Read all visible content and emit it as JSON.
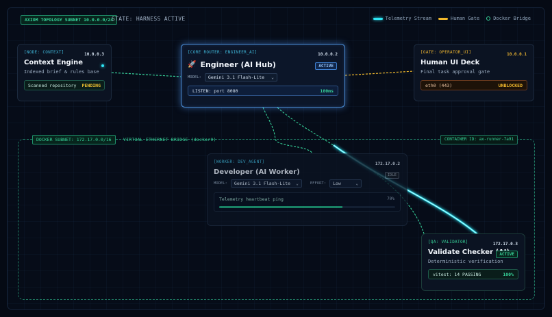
{
  "header": {
    "badge": "AXIOM TOPOLOGY SUBNET 10.0.0.0/24",
    "state": "STATE: HARNESS ACTIVE",
    "legend": [
      {
        "label": "Telemetry Stream",
        "color": "#2ee6f5"
      },
      {
        "label": "Human Gate",
        "color": "#f2b92c"
      },
      {
        "label": "Docker Bridge",
        "color": "#37d39a"
      }
    ]
  },
  "context": {
    "tag": "[NODE: CONTEXT]",
    "ip": "10.0.0.3",
    "title": "Context Engine",
    "subtitle": "Indexed brief & rules base",
    "status_label": "Scanned repository",
    "status_value": "PENDING"
  },
  "engineer": {
    "tag": "[CORE ROUTER: ENGINEER_AI]",
    "ip": "10.0.0.2",
    "title": "Engineer (AI Hub)",
    "badge": "ACTIVE",
    "model_label": "MODEL:",
    "model_value": "Gemini 3.1 Flash-Lite",
    "listen_label": "LISTEN: port 8080",
    "listen_value": "100ms"
  },
  "human": {
    "tag": "[GATE: OPERATOR_UI]",
    "ip": "10.0.0.1",
    "title": "Human UI Deck",
    "subtitle": "Final task approval gate",
    "status_label": "eth0 (443)",
    "status_value": "UNBLOCKED"
  },
  "subnet": {
    "badge": "DOCKER SUBNET: 172.17.0.0/16",
    "label": "VIRTUAL ETHERNET BRIDGE (docker0)",
    "container": "CONTAINER ID: ax-runner-7a91"
  },
  "developer": {
    "tag": "[WORKER: DEV_AGENT]",
    "ip": "172.17.0.2",
    "title": "Developer (AI Worker)",
    "badge": "IDLE",
    "model_label": "MODEL:",
    "model_value": "Gemini 3.1 Flash-Lite",
    "effort_label": "EFFORT:",
    "effort_value": "Low",
    "heartbeat_label": "Telemetry heartbeat ping",
    "heartbeat_percent": "70%",
    "heartbeat_fraction": 0.7
  },
  "qa": {
    "tag": "[QA: VALIDATOR]",
    "ip": "172.17.0.3",
    "title": "Validate Checker (AI)",
    "badge": "ACTIVE",
    "subtitle": "Deterministic verification",
    "status_label": "vitest: 14 PASSING",
    "status_value": "100%"
  }
}
